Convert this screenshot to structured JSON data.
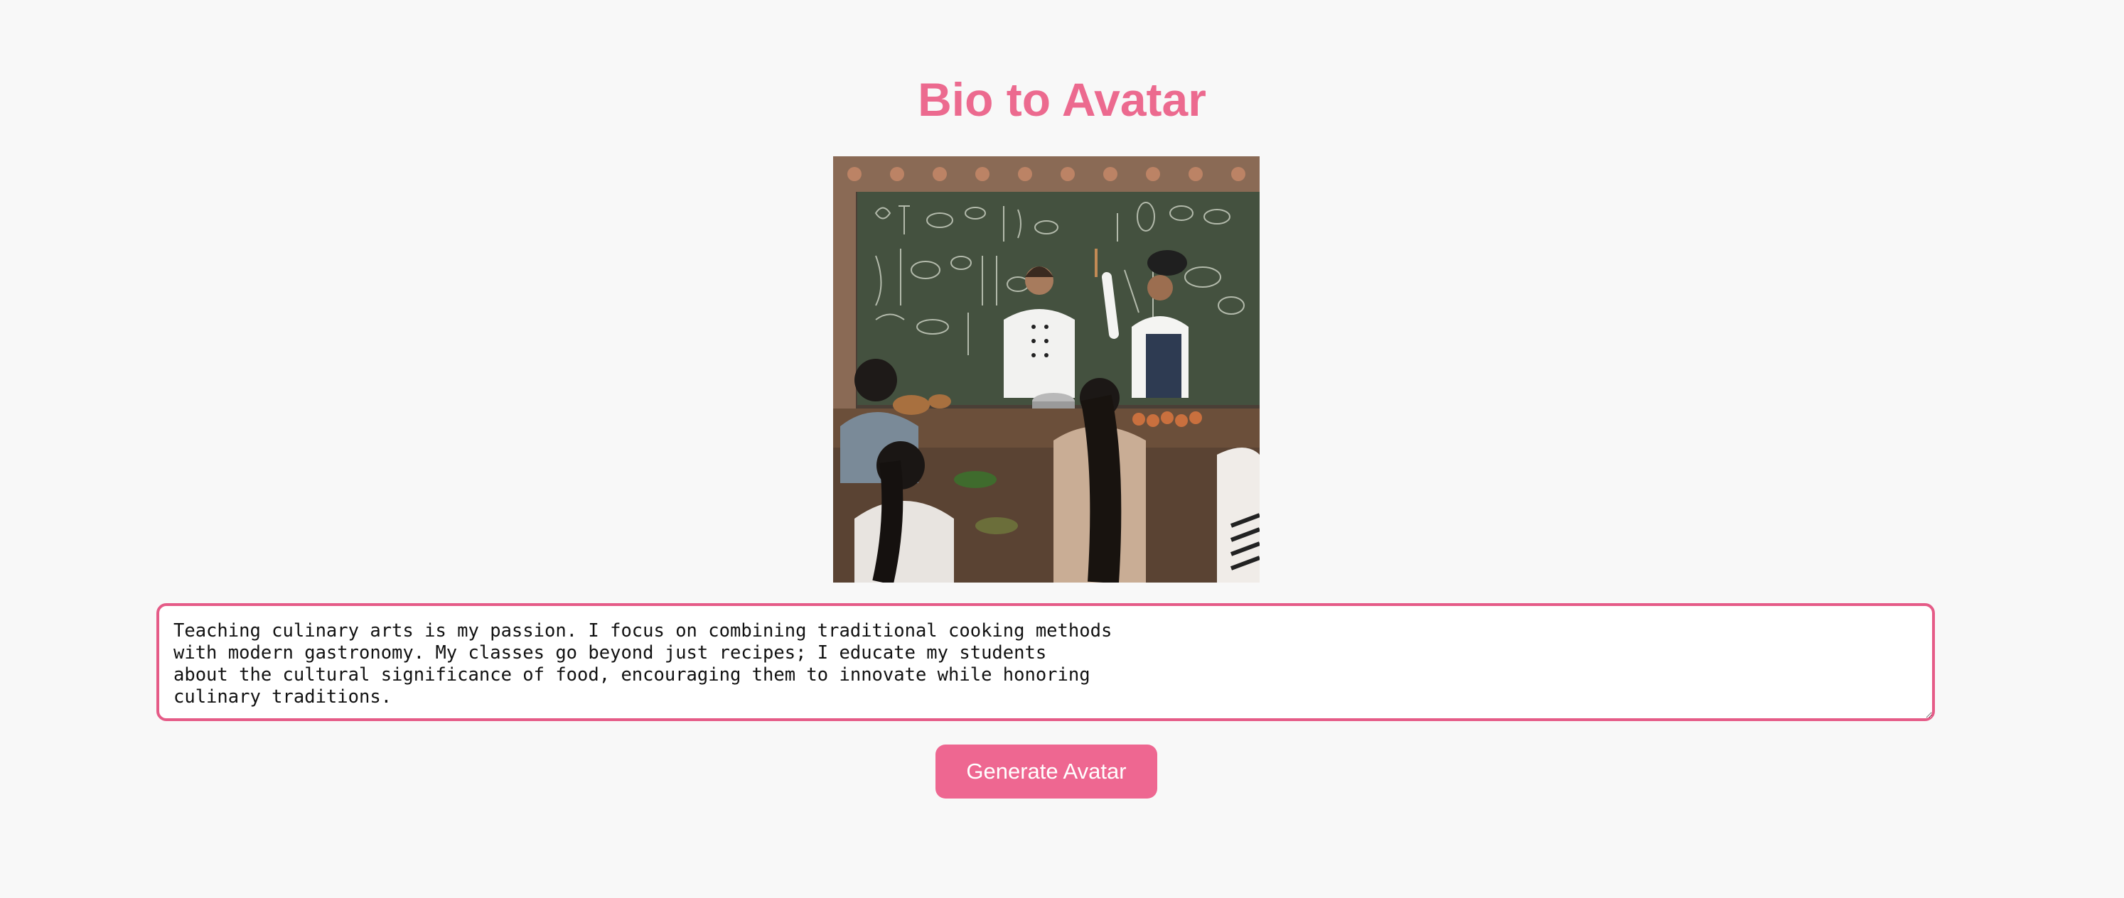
{
  "header": {
    "title": "Bio to Avatar"
  },
  "avatar": {
    "description_icon": "avatar-image"
  },
  "bio": {
    "value": "Teaching culinary arts is my passion. I focus on combining traditional cooking methods\nwith modern gastronomy. My classes go beyond just recipes; I educate my students\nabout the cultural significance of food, encouraging them to innovate while honoring\nculinary traditions."
  },
  "actions": {
    "generate_label": "Generate Avatar"
  },
  "colors": {
    "accent": "#ee6791",
    "title": "#ec6a8f",
    "border": "#e55b87",
    "background": "#f8f8f8"
  }
}
